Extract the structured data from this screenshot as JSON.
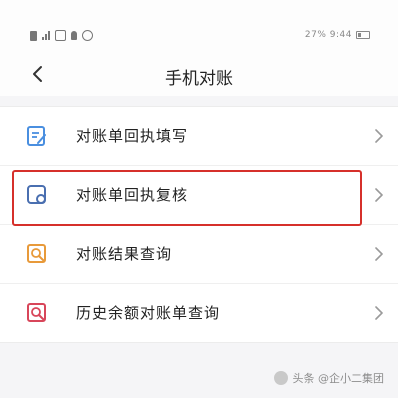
{
  "status_bar": {
    "right_text": "27% 9:44"
  },
  "header": {
    "title": "手机对账",
    "back_icon": "chevron-left-icon"
  },
  "menu": {
    "items": [
      {
        "label": "对账单回执填写",
        "icon": "edit-form-icon",
        "icon_color": "#4a8fe0"
      },
      {
        "label": "对账单回执复核",
        "icon": "review-icon",
        "icon_color": "#4a6fb0"
      },
      {
        "label": "对账结果查询",
        "icon": "result-search-icon",
        "icon_color": "#e89a3a"
      },
      {
        "label": "历史余额对账单查询",
        "icon": "history-search-icon",
        "icon_color": "#d8465a"
      }
    ]
  },
  "highlight_color": "#d6302b",
  "watermark": {
    "text": "头条 @企小二集团"
  }
}
